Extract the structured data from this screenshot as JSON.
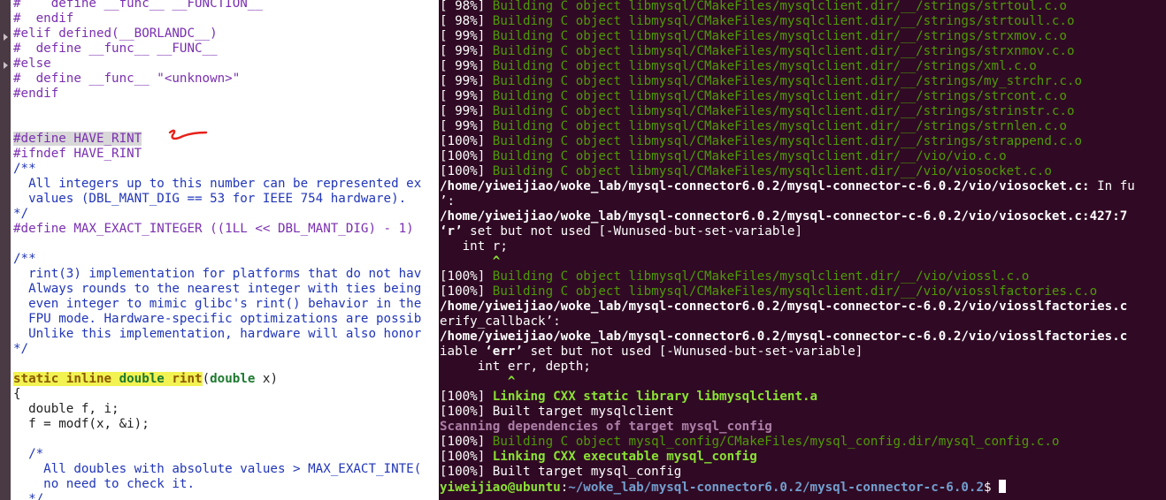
{
  "editor": {
    "lines": [
      "#    define __func__ __FUNCTION__",
      "#  endif",
      "#elif defined(__BORLANDC__)",
      "#  define __func__ __FUNC__",
      "#else",
      "#  define __func__ \"<unknown>\"",
      "#endif",
      "",
      "",
      "#define HAVE_RINT",
      "#ifndef HAVE_RINT",
      "/**",
      "  All integers up to this number can be represented ex",
      "  values (DBL_MANT_DIG == 53 for IEEE 754 hardware).",
      "*/",
      "#define MAX_EXACT_INTEGER ((1LL << DBL_MANT_DIG) - 1)",
      "",
      "/**",
      "  rint(3) implementation for platforms that do not hav",
      "  Always rounds to the nearest integer with ties being",
      "  even integer to mimic glibc's rint() behavior in the",
      "  FPU mode. Hardware-specific optimizations are possib",
      "  Unlike this implementation, hardware will also honor",
      "*/",
      "",
      "static inline double rint(double x)",
      "{",
      "  double f, i;",
      "  f = modf(x, &i);",
      "",
      "  /*",
      "    All doubles with absolute values > MAX_EXACT_INTE(",
      "    no need to check it.",
      "  */"
    ]
  },
  "terminal": {
    "build_lines": [
      {
        "pct": "[ 98%] ",
        "msg": "Building C object libmysql/CMakeFiles/mysqlclient.dir/__/strings/strtoul.c.o"
      },
      {
        "pct": "[ 98%] ",
        "msg": "Building C object libmysql/CMakeFiles/mysqlclient.dir/__/strings/strtoull.c.o"
      },
      {
        "pct": "[ 99%] ",
        "msg": "Building C object libmysql/CMakeFiles/mysqlclient.dir/__/strings/strxmov.c.o"
      },
      {
        "pct": "[ 99%] ",
        "msg": "Building C object libmysql/CMakeFiles/mysqlclient.dir/__/strings/strxnmov.c.o"
      },
      {
        "pct": "[ 99%] ",
        "msg": "Building C object libmysql/CMakeFiles/mysqlclient.dir/__/strings/xml.c.o"
      },
      {
        "pct": "[ 99%] ",
        "msg": "Building C object libmysql/CMakeFiles/mysqlclient.dir/__/strings/my_strchr.c.o"
      },
      {
        "pct": "[ 99%] ",
        "msg": "Building C object libmysql/CMakeFiles/mysqlclient.dir/__/strings/strcont.c.o"
      },
      {
        "pct": "[ 99%] ",
        "msg": "Building C object libmysql/CMakeFiles/mysqlclient.dir/__/strings/strinstr.c.o"
      },
      {
        "pct": "[ 99%] ",
        "msg": "Building C object libmysql/CMakeFiles/mysqlclient.dir/__/strings/strnlen.c.o"
      },
      {
        "pct": "[100%] ",
        "msg": "Building C object libmysql/CMakeFiles/mysqlclient.dir/__/strings/strappend.c.o"
      },
      {
        "pct": "[100%] ",
        "msg": "Building C object libmysql/CMakeFiles/mysqlclient.dir/__/vio/vio.c.o"
      },
      {
        "pct": "[100%] ",
        "msg": "Building C object libmysql/CMakeFiles/mysqlclient.dir/__/vio/viosocket.c.o"
      }
    ],
    "warn1_path": "/home/yiweijiao/woke_lab/mysql-connector6.0.2/mysql-connector-c-6.0.2/vio/viosocket.c:",
    "warn1_rest": " In fu",
    "warn1_line2": "’:",
    "warn2_path": "/home/yiweijiao/woke_lab/mysql-connector6.0.2/mysql-connector-c-6.0.2/vio/viosocket.c:427:7",
    "warn2_q": "‘r’",
    "warn2_msg": " set but not used [-Wunused-but-set-variable]",
    "code1": "   int r;",
    "caret1_pad": "       ",
    "caret": "^",
    "build2": [
      {
        "pct": "[100%] ",
        "msg": "Building C object libmysql/CMakeFiles/mysqlclient.dir/__/vio/viossl.c.o"
      },
      {
        "pct": "[100%] ",
        "msg": "Building C object libmysql/CMakeFiles/mysqlclient.dir/__/vio/viosslfactories.c.o"
      }
    ],
    "warn3_path": "/home/yiweijiao/woke_lab/mysql-connector6.0.2/mysql-connector-c-6.0.2/vio/viosslfactories.c",
    "warn3_line2": "erify_callback’:",
    "warn4_path": "/home/yiweijiao/woke_lab/mysql-connector6.0.2/mysql-connector-c-6.0.2/vio/viosslfactories.c",
    "warn4_pre": "iable ",
    "warn4_q": "‘err’",
    "warn4_msg": " set but not used [-Wunused-but-set-variable]",
    "code2": "     int err, depth;",
    "caret2_pad": "         ",
    "link1_pct": "[100%] ",
    "link1_msg": "Linking CXX static library libmysqlclient.a",
    "built1": "[100%] Built target mysqlclient",
    "scan": "Scanning dependencies of target mysql_config",
    "build3_pct": "[100%] ",
    "build3_msg": "Building C object mysql_config/CMakeFiles/mysql_config.dir/mysql_config.c.o",
    "link2_pct": "[100%] ",
    "link2_msg": "Linking CXX executable mysql_config",
    "built2": "[100%] Built target mysql_config",
    "prompt_user": "yiweijiao@ubuntu",
    "prompt_colon": ":",
    "prompt_path": "~/woke_lab/mysql-connector6.0.2/mysql-connector-c-6.0.2",
    "prompt_sign": "$ "
  }
}
